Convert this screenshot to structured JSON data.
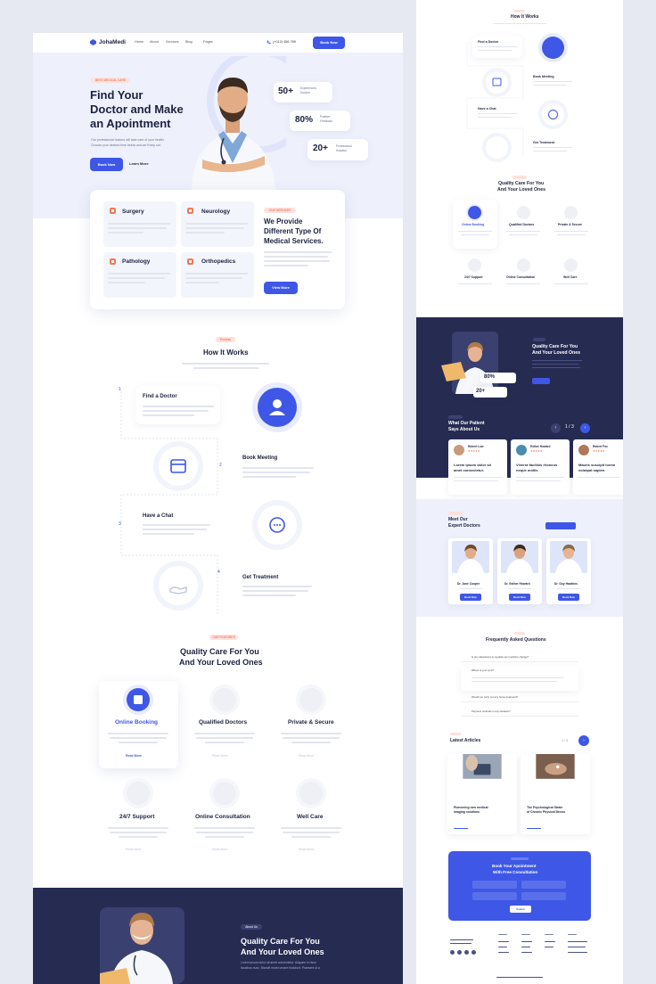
{
  "brand": "JohaMedi",
  "nav": {
    "items": [
      "Home",
      "About",
      "Services",
      "Blog",
      "Pages"
    ],
    "phone": "(+012) 456 789",
    "book": "Book Now"
  },
  "hero": {
    "badge": "BEST MEDICAL CARE",
    "title1": "Find Your",
    "title2": "Doctor and Make",
    "title3": "an Apointment",
    "desc1": "Our professional doctors will take care of your health.",
    "desc2": "Choose your desired time below and we'll help out.",
    "book": "Book Now",
    "learn": "Learn More",
    "stats": [
      {
        "n": "50+",
        "l1": "Experienced",
        "l2": "Doctors"
      },
      {
        "n": "80%",
        "l1": "Positive",
        "l2": "Feedback"
      },
      {
        "n": "20+",
        "l1": "Professional",
        "l2": "Hospital"
      }
    ]
  },
  "services": {
    "items": [
      {
        "t": "Surgery"
      },
      {
        "t": "Neurology"
      },
      {
        "t": "Pathology"
      },
      {
        "t": "Orthopedics"
      }
    ],
    "badge": "OUR SERVICES",
    "h1": "We Provide",
    "h2": "Different Type Of",
    "h3": "Medical Services.",
    "btn": "View More"
  },
  "how": {
    "badge": "Process",
    "title": "How It Works",
    "steps": [
      {
        "n": "1",
        "t": "Find a Doctor"
      },
      {
        "n": "2",
        "t": "Book Meeting"
      },
      {
        "n": "3",
        "t": "Have a Chat"
      },
      {
        "n": "4",
        "t": "Get Treatment"
      }
    ]
  },
  "quality": {
    "badge": "OUR FEATURES",
    "t1": "Quality Care For You",
    "t2": "And Your Loved Ones",
    "items": [
      {
        "t": "Online Booking"
      },
      {
        "t": "Qualified Doctors"
      },
      {
        "t": "Private & Secure"
      },
      {
        "t": "24/7 Support"
      },
      {
        "t": "Online Consultation"
      },
      {
        "t": "Well Care"
      }
    ],
    "more": "Read More"
  },
  "about": {
    "badge": "About Us",
    "t1": "Quality Care For You",
    "t2": "And Your Loved Ones",
    "desc1": "Lorem ipsum dolor sit amet consectetur. Aliquam in risus",
    "desc2": "faucibus nunc. Blandit morbi ornare tincidunt. Praesent id a"
  },
  "right": {
    "how": "How It Works",
    "steps": [
      "Find a Doctor",
      "Book Meeting",
      "Have a Chat",
      "Get Treatment"
    ],
    "q1": "Quality Care For You",
    "q2": "And Your Loved Ones",
    "items": [
      "Online Booking",
      "Qualified Doctors",
      "Private & Secure",
      "24/7 Support",
      "Online Consultation",
      "Well Care"
    ],
    "about1": "Quality Care For You",
    "about2": "And Your Loved Ones",
    "s80": "80%",
    "s20": "20+",
    "test1": "What Our Patient",
    "test2": "Says About Us",
    "page": "1 / 3",
    "reviews": [
      {
        "name": "Robert Low",
        "q1": "Lorem ipsum dolor sit",
        "q2": "amet consectetur."
      },
      {
        "name": "Esther Howard",
        "q1": "Viverra facilisis rhoncus",
        "q2": "neque mollis"
      },
      {
        "name": "Robert Fox",
        "q1": "Mauris suscipit lorem",
        "q2": "volutpat sapien"
      }
    ],
    "doc1": "Meet Our",
    "doc2": "Expert Doctors",
    "doctors": [
      {
        "name": "Dr. Jane Cooper"
      },
      {
        "name": "Dr. Esther Howard"
      },
      {
        "name": "Dr. Guy Hawkins"
      }
    ],
    "docBtn": "Book Now",
    "faq": "Frequently Asked Questions",
    "faqs": [
      "Is any adjustment to regulate per medicine change?",
      "Where is your sync?",
      "Would you carry out any home treatment?",
      "Payment methods in any situation?"
    ],
    "articles": "Latest Articles",
    "pager": "1 / 3",
    "posts": [
      {
        "t1": "Pioneering new medical",
        "t2": "imaging solutions"
      },
      {
        "t1": "The Psychological Strain",
        "t2": "of Chronic Physical Illness"
      }
    ],
    "cta1": "Book Your Apointment",
    "cta2": "With Free Consultation",
    "send": "Submit",
    "footBrand": "JohaMedi"
  }
}
